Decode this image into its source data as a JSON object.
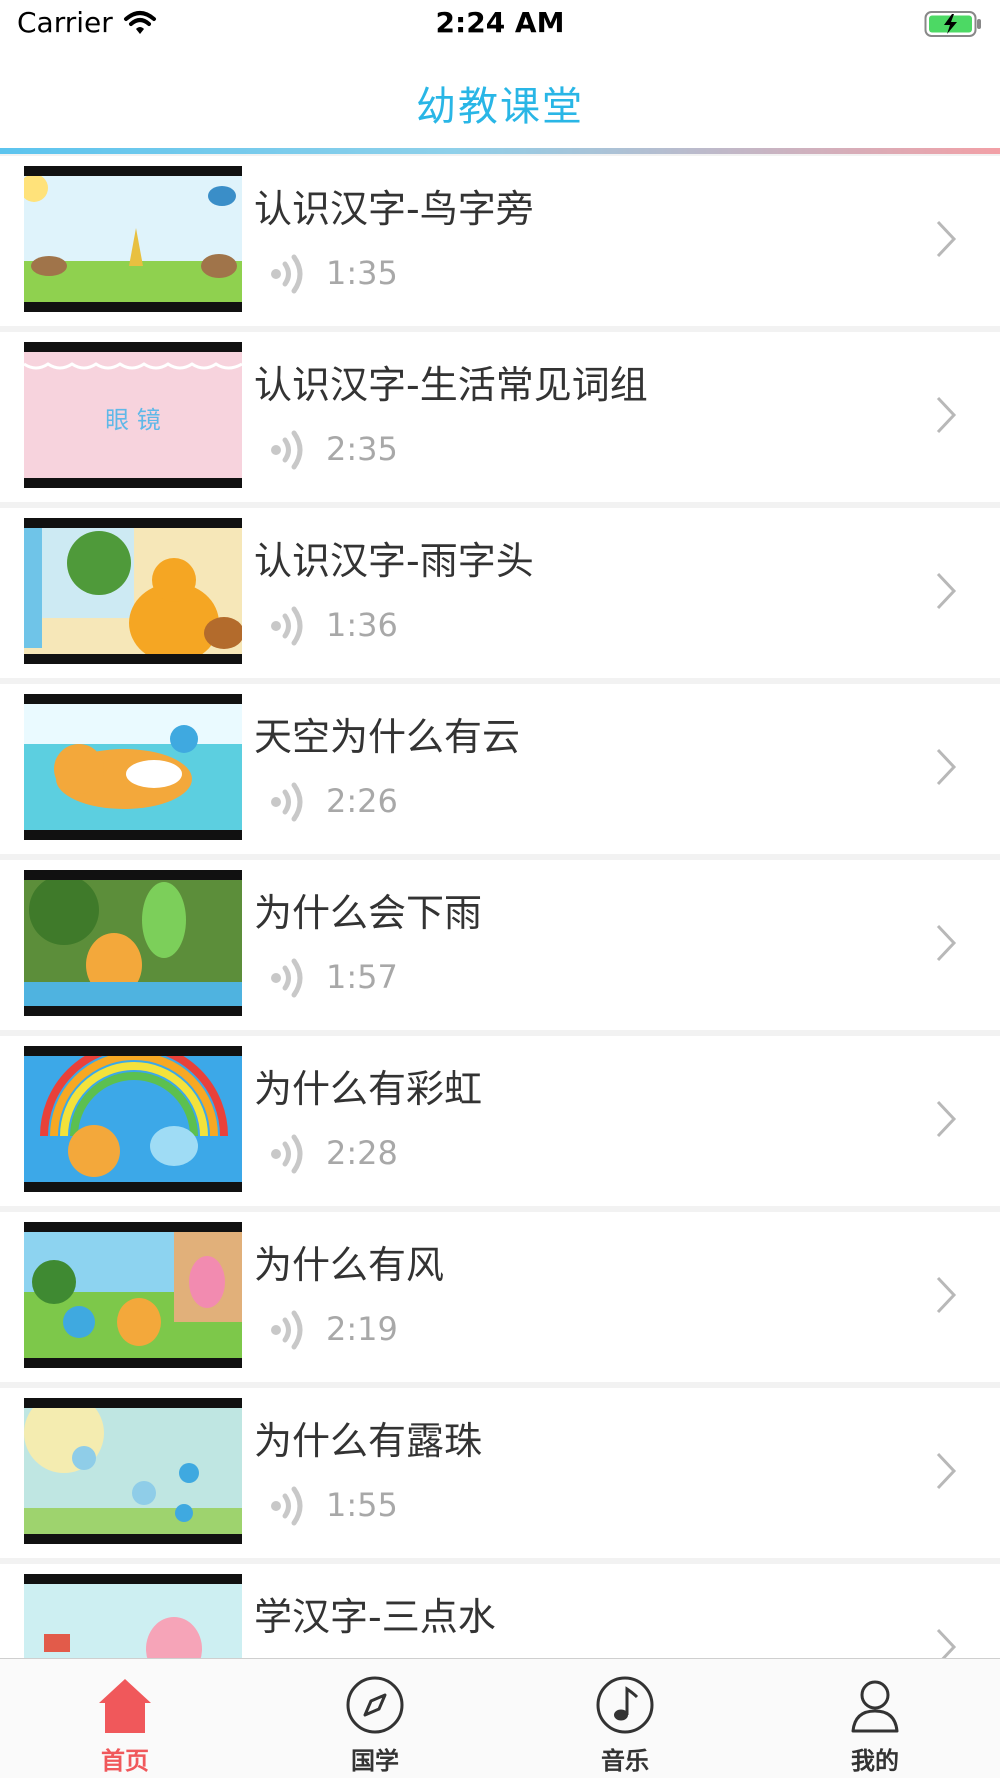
{
  "status_bar": {
    "carrier": "Carrier",
    "time": "2:24 AM"
  },
  "nav": {
    "title": "幼教课堂"
  },
  "list": {
    "items": [
      {
        "title": "认识汉字-鸟字旁",
        "duration": "1:35"
      },
      {
        "title": "认识汉字-生活常见词组",
        "duration": "2:35",
        "thumb_text": "眼 镜"
      },
      {
        "title": "认识汉字-雨字头",
        "duration": "1:36"
      },
      {
        "title": "天空为什么有云",
        "duration": "2:26"
      },
      {
        "title": "为什么会下雨",
        "duration": "1:57"
      },
      {
        "title": "为什么有彩虹",
        "duration": "2:28"
      },
      {
        "title": "为什么有风",
        "duration": "2:19"
      },
      {
        "title": "为什么有露珠",
        "duration": "1:55"
      },
      {
        "title": "学汉字-三点水",
        "duration": ""
      }
    ]
  },
  "tabs": [
    {
      "label": "首页",
      "icon": "home-icon",
      "active": true
    },
    {
      "label": "国学",
      "icon": "compass-icon",
      "active": false
    },
    {
      "label": "音乐",
      "icon": "music-note-icon",
      "active": false
    },
    {
      "label": "我的",
      "icon": "person-icon",
      "active": false
    }
  ],
  "colors": {
    "accent": "#29b6e6",
    "tab_active": "#f0585b",
    "battery": "#4cd964"
  }
}
